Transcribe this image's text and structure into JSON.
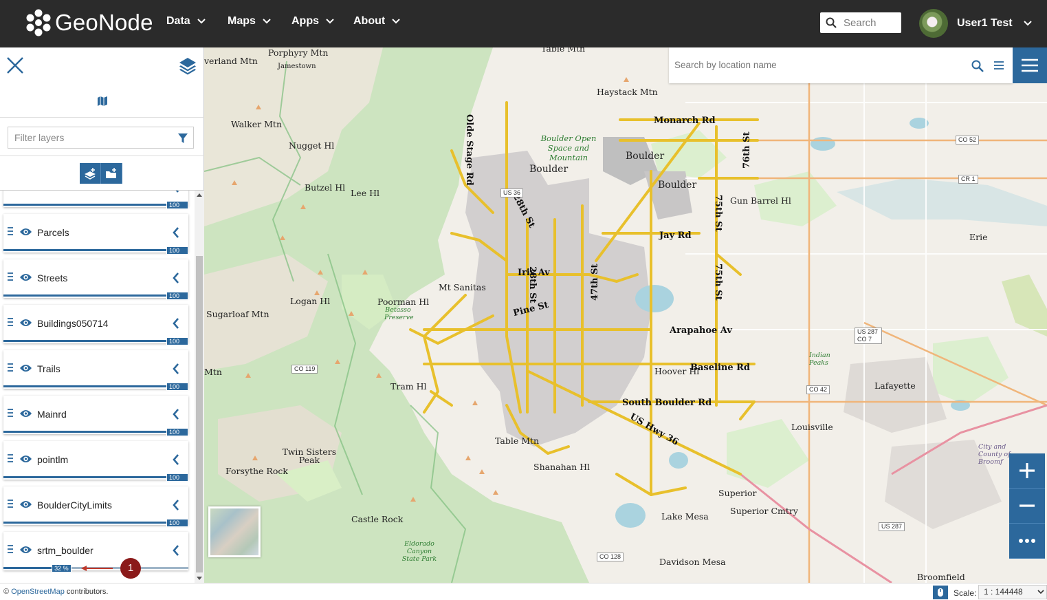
{
  "navbar": {
    "brand": "GeoNode",
    "menu": [
      {
        "label": "Data"
      },
      {
        "label": "Maps"
      },
      {
        "label": "Apps"
      },
      {
        "label": "About"
      }
    ],
    "search_placeholder": "Search",
    "user_name": "User1 Test"
  },
  "sidebar": {
    "filter_placeholder": "Filter layers",
    "layers": [
      {
        "name": "",
        "opacity": "100 %",
        "opacity_value": 1.0
      },
      {
        "name": "Parcels",
        "opacity": "100 %",
        "opacity_value": 1.0
      },
      {
        "name": "Streets",
        "opacity": "100 %",
        "opacity_value": 1.0
      },
      {
        "name": "Buildings050714",
        "opacity": "100 %",
        "opacity_value": 1.0
      },
      {
        "name": "Trails",
        "opacity": "100 %",
        "opacity_value": 1.0
      },
      {
        "name": "Mainrd",
        "opacity": "100 %",
        "opacity_value": 1.0
      },
      {
        "name": "pointlm",
        "opacity": "100 %",
        "opacity_value": 1.0
      },
      {
        "name": "BoulderCityLimits",
        "opacity": "100 %",
        "opacity_value": 1.0
      },
      {
        "name": "srtm_boulder",
        "opacity": "32 %",
        "opacity_value": 0.32
      }
    ],
    "annotation_number": "1"
  },
  "map": {
    "location_search_placeholder": "Search by location name",
    "places": [
      "verland Mtn",
      "Porphyry Mtn",
      "Jamestown",
      "Table Mtn",
      "Haystack Mtn",
      "Walker Mtn",
      "Nugget Hl",
      "Boulder",
      "Boulder",
      "Boulder",
      "Butzel Hl",
      "Lee Hl",
      "Gun Barrel Hl",
      "Erie",
      "Mt Sanitas",
      "Logan Hl",
      "Poorman Hl",
      "Sugarloaf Mtn",
      "Mtn",
      "Tram Hl",
      "Lafayette",
      "Louisville",
      "Table Mtn",
      "Twin Sisters Peak",
      "Forsythe Rock",
      "Shanahan Hl",
      "Superior",
      "Superior Cmtry",
      "Castle Rock",
      "Lake Mesa",
      "Davidson Mesa",
      "Broomfield",
      "Hoover Hl",
      "Monarch Rd",
      "Jay Rd",
      "Iris Av",
      "Pine St",
      "Arapahoe Av",
      "Baseline Rd",
      "South Boulder Rd",
      "US Hwy 36",
      "28th St",
      "28th St",
      "47th St",
      "75th St",
      "75th St",
      "76th St",
      "Olde Stage Rd"
    ],
    "shields": [
      "CO 52",
      "CR 1",
      "US 287 CO 7",
      "CO 42",
      "CO 119",
      "US 287",
      "CO 128",
      "US 36"
    ],
    "green_labels": [
      "Boulder Open Space and Mountain",
      "Betasso Preserve",
      "Eldorado Canyon State Park",
      "Indian Peaks",
      "City and County of Broomf"
    ],
    "attribution_prefix": "©",
    "attribution_link": "OpenStreetMap",
    "attribution_suffix": "contributors.",
    "scale_label": "Scale:",
    "scale_value": "1 : 144448"
  },
  "icons": {
    "close": "close-icon",
    "layers": "layers-icon",
    "map": "map-icon",
    "filter": "filter-icon",
    "add_layer": "add-layer-icon",
    "add_group": "add-group-icon",
    "drag": "drag-handle-icon",
    "eye": "eye-icon",
    "collapse": "chevron-left-icon",
    "search": "search-icon",
    "list": "list-icon",
    "menu": "hamburger-icon",
    "zoom_in": "plus-icon",
    "zoom_out": "minus-icon",
    "more": "ellipsis-icon",
    "mouse": "mouse-icon"
  },
  "colors": {
    "navbar": "#2b2b2b",
    "accent": "#2c689c",
    "road": "#e8c02c",
    "annotation": "#8b1a1a"
  }
}
